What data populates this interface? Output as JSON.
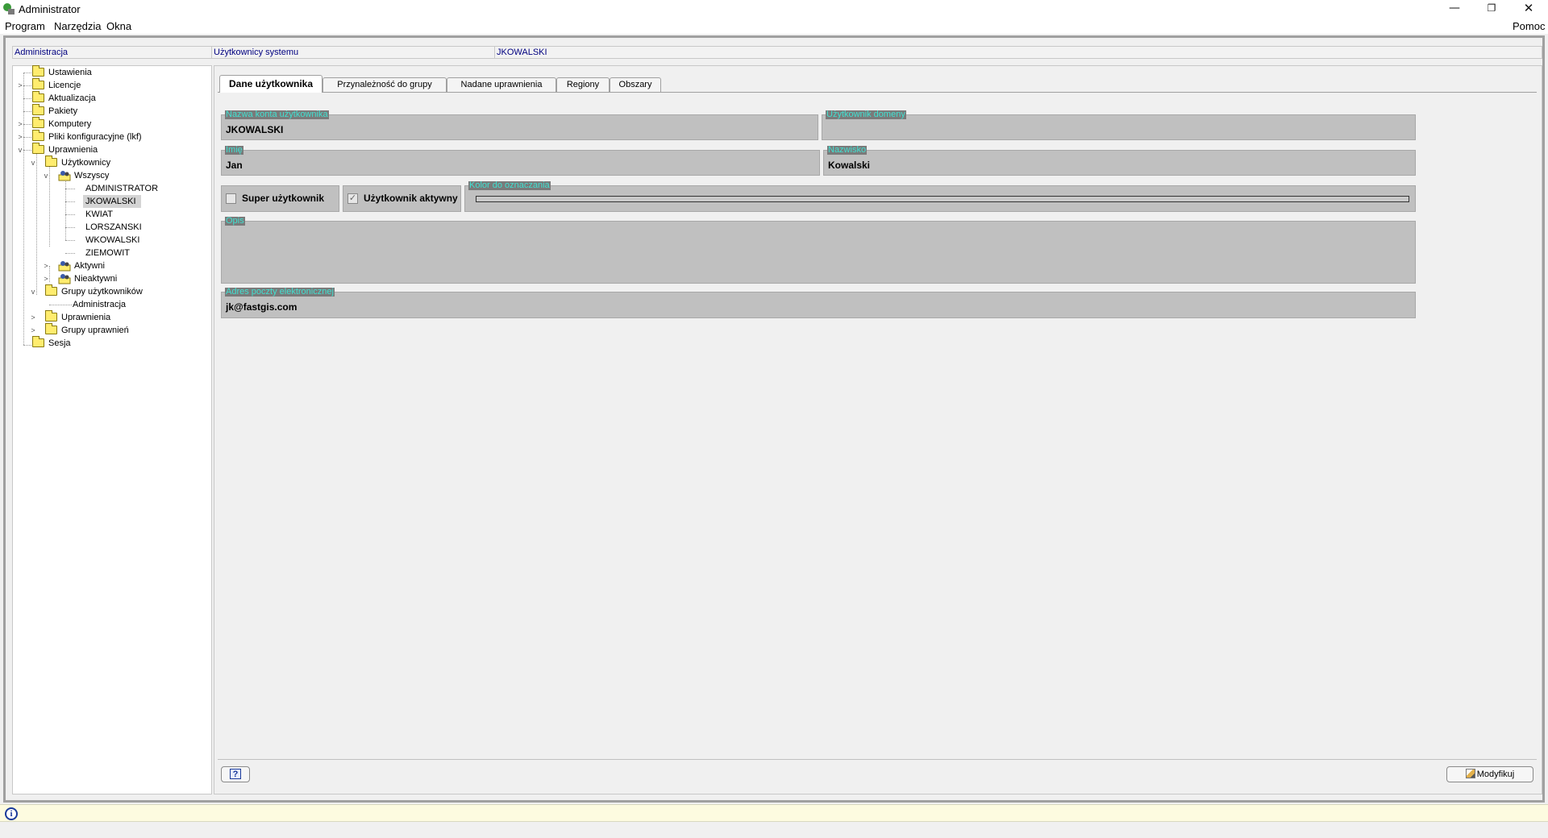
{
  "window": {
    "title": "Administrator",
    "min": "—",
    "max": "❐",
    "close": "✕"
  },
  "menu": {
    "items": [
      "Program",
      "Narzędzia",
      "Okna"
    ],
    "help": "Pomoc"
  },
  "header": {
    "left": "Administracja",
    "middle": "Użytkownicy systemu",
    "right": "JKOWALSKI"
  },
  "tree": {
    "ustawienia": "Ustawienia",
    "licencje": "Licencje",
    "aktualizacja": "Aktualizacja",
    "pakiety": "Pakiety",
    "komputery": "Komputery",
    "pliki": "Pliki konfiguracyjne (lkf)",
    "uprawnienia": "Uprawnienia",
    "uzytkownicy": "Użytkownicy",
    "wszyscy": "Wszyscy",
    "users": [
      "ADMINISTRATOR",
      "JKOWALSKI",
      "KWIAT",
      "LORSZANSKI",
      "WKOWALSKI",
      "ZIEMOWIT"
    ],
    "aktywni": "Aktywni",
    "nieaktywni": "Nieaktywni",
    "grupy_uzytkownikow": "Grupy użytkowników",
    "administracja": "Administracja",
    "uprawnienia2": "Uprawnienia",
    "grupy_uprawnien": "Grupy uprawnień",
    "sesja": "Sesja"
  },
  "tabs": [
    "Dane użytkownika",
    "Przynależność do grupy",
    "Nadane uprawnienia",
    "Regiony",
    "Obszary"
  ],
  "form": {
    "account_label": "Nazwa konta użytkownika",
    "account_value": "JKOWALSKI",
    "domain_label": "Użytkownik domeny",
    "domain_value": "",
    "first_label": "Imię",
    "first_value": "Jan",
    "last_label": "Nazwisko",
    "last_value": "Kowalski",
    "super_label": "Super użytkownik",
    "super_checked": false,
    "active_label": "Użytkownik aktywny",
    "active_checked": true,
    "color_label": "Kolor do oznaczania",
    "desc_label": "Opis",
    "desc_value": "",
    "email_label": "Adres poczty elektronicznej",
    "email_value": "jk@fastgis.com"
  },
  "buttons": {
    "help": "?",
    "modify": "Modyfikuj"
  },
  "status": {
    "icon": "i"
  }
}
